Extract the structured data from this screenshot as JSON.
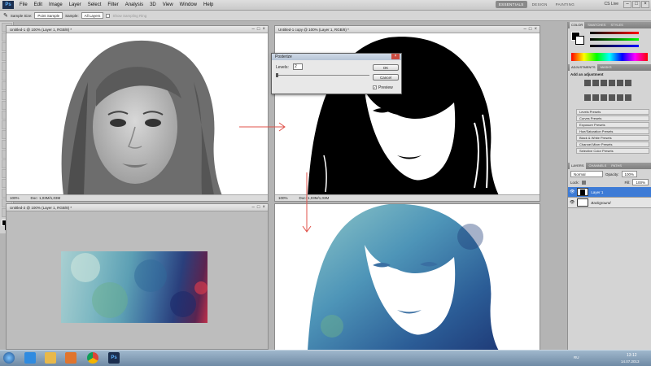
{
  "app": {
    "logo": "Ps"
  },
  "menu": [
    "File",
    "Edit",
    "Image",
    "Layer",
    "Select",
    "Filter",
    "Analysis",
    "3D",
    "View",
    "Window",
    "Help"
  ],
  "workspaces": {
    "essentials": "ESSENTIALS",
    "design": "DESIGN",
    "painting": "PAINTING"
  },
  "cs_live": "CS Live",
  "options": {
    "sample_size_label": "Sample Size:",
    "sample_size_value": "Point Sample",
    "sample_label": "Sample:",
    "sample_value": "All Layers",
    "show_ring": "Show Sampling Ring"
  },
  "docs": {
    "d1": {
      "title": "Untitled-1 @ 100% (Layer 1, RGB/8) *",
      "zoom": "100%",
      "info": "Doc: 1,03M/1,03M"
    },
    "d2": {
      "title": "Untitled-1 copy @ 100% (Layer 1, RGB/8) *",
      "zoom": "100%",
      "info": "Doc: 1,03M/1,03M"
    },
    "d3": {
      "title": "Untitled-2 @ 100% (Layer 1, RGB/8) *"
    },
    "d4": {
      "title": ""
    }
  },
  "dialog": {
    "title": "Posterize",
    "levels_label": "Levels:",
    "levels_value": "2",
    "ok": "OK",
    "cancel": "Cancel",
    "preview": "Preview"
  },
  "dock": {
    "color_tabs": [
      "COLOR",
      "SWATCHES",
      "STYLES"
    ],
    "adj_tabs": [
      "ADJUSTMENTS",
      "MASKS"
    ],
    "adj_title": "Add an adjustment",
    "presets": [
      "Levels Presets",
      "Curves Presets",
      "Exposure Presets",
      "Hue/Saturation Presets",
      "Black & White Presets",
      "Channel Mixer Presets",
      "Selective Color Presets"
    ],
    "layer_tabs": [
      "LAYERS",
      "CHANNELS",
      "PATHS"
    ],
    "blend_mode": "Normal",
    "opacity_label": "Opacity:",
    "opacity_value": "100%",
    "lock_label": "Lock:",
    "fill_label": "Fill:",
    "fill_value": "100%",
    "layers": [
      {
        "name": "Layer 1",
        "selected": true
      },
      {
        "name": "Background",
        "selected": false
      }
    ]
  },
  "taskbar": {
    "time": "13:12",
    "date": "14.07.2013",
    "lang": "RU"
  },
  "colors": {
    "accent": "#3d7bd6",
    "arrow": "#e0524a",
    "selected_layer": "#3d7bd6"
  }
}
